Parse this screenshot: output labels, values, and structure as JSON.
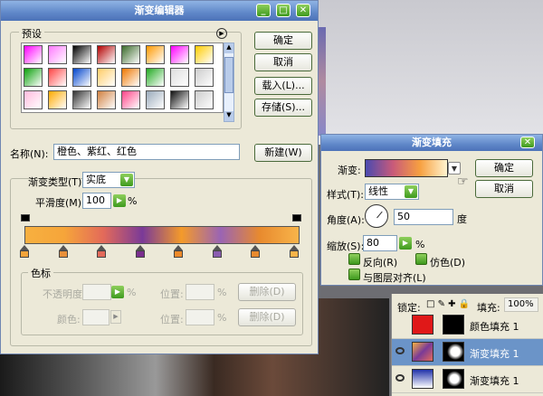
{
  "gradient_editor": {
    "title": "渐变编辑器",
    "presets_label": "预设",
    "buttons": {
      "ok": "确定",
      "cancel": "取消",
      "load": "载入(L)...",
      "save": "存储(S)...",
      "new": "新建(W)"
    },
    "name_label": "名称(N):",
    "name_value": "橙色、紫红、红色",
    "gradient_type_label": "渐变类型(T):",
    "gradient_type_value": "实底",
    "smoothness_label": "平滑度(M):",
    "smoothness_value": "100",
    "percent": "%",
    "stops_group_label": "色标",
    "opacity_label": "不透明度:",
    "location_label": "位置:",
    "delete_label": "删除(D)",
    "color_label": "颜色:",
    "preset_swatches": [
      "#ff00ff",
      "#ff7aff",
      "#000000",
      "#b30000",
      "#3a6a2a",
      "#ff9900",
      "#ff00ff",
      "#ffcc00",
      "#0aa00a",
      "#ff4444",
      "#0044cc",
      "#ffcc66",
      "#ee7700",
      "#22aa22",
      "#dddddd",
      "#cccccc",
      "#ffbbdd",
      "#ffaa00",
      "#333333",
      "#d08040",
      "#ff4488",
      "#99aabb",
      "#111111",
      "#cccccc"
    ],
    "gradient_colors": [
      "#f7b040",
      "#f6a53a",
      "#e36a5a",
      "#7a3a98",
      "#f49a2a",
      "#9a64b4",
      "#e88a2e",
      "#f8b44a"
    ],
    "stop_colors": [
      "#f2a43a",
      "#e8903a",
      "#e26a5a",
      "#7a2e8e",
      "#ee8a2a",
      "#8a5cb0",
      "#e88a2e",
      "#f8b44a"
    ]
  },
  "gradient_fill": {
    "title": "渐变填充",
    "gradient_label": "渐变:",
    "style_label": "样式(T):",
    "style_value": "线性",
    "angle_label": "角度(A):",
    "angle_value": "50",
    "degree_unit": "度",
    "scale_label": "缩放(S):",
    "scale_value": "80",
    "percent": "%",
    "reverse_label": "反向(R)",
    "dither_label": "仿色(D)",
    "align_label": "与图层对齐(L)",
    "ok": "确定",
    "cancel": "取消"
  },
  "layers": {
    "lock_label": "锁定:",
    "fill_label": "填充:",
    "fill_value": "100%",
    "items": [
      {
        "name": "颜色填充 1"
      },
      {
        "name": "渐变填充 1"
      },
      {
        "name": "渐变填充 1"
      }
    ]
  },
  "colors": {
    "title_bar": "#5f87c8",
    "panel": "#ece9d8",
    "accent_green": "#3e9a1e"
  }
}
